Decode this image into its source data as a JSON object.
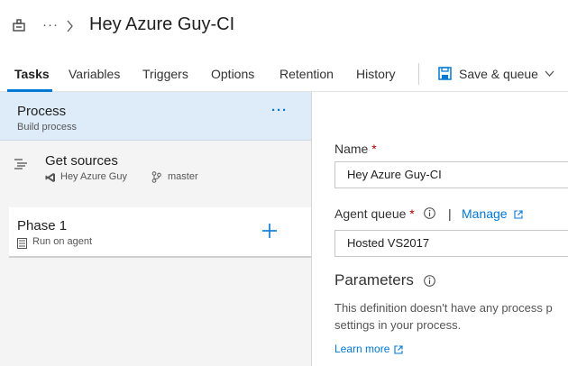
{
  "header": {
    "more": "···",
    "title": "Hey Azure Guy-CI"
  },
  "tabs": [
    {
      "label": "Tasks",
      "active": true
    },
    {
      "label": "Variables"
    },
    {
      "label": "Triggers"
    },
    {
      "label": "Options"
    },
    {
      "label": "Retention"
    },
    {
      "label": "History"
    }
  ],
  "toolbar": {
    "save_label": "Save & queue"
  },
  "process": {
    "title": "Process",
    "subtitle": "Build process",
    "more": "···"
  },
  "get_sources": {
    "title": "Get sources",
    "repo": "Hey Azure Guy",
    "branch": "master"
  },
  "phase": {
    "title": "Phase 1",
    "subtitle": "Run on agent"
  },
  "form": {
    "name_label": "Name",
    "required_mark": "*",
    "name_value": "Hey Azure Guy-CI",
    "agent_queue_label": "Agent queue",
    "pipe": "|",
    "manage_label": "Manage",
    "agent_queue_value": "Hosted VS2017",
    "parameters_title": "Parameters",
    "parameters_desc_line1": "This definition doesn't have any process p",
    "parameters_desc_line2": "settings in your process.",
    "learn_more": "Learn more"
  },
  "colors": {
    "accent": "#0078d4",
    "selected_bg": "#deecf9",
    "panel_bg": "#f4f4f4",
    "required": "#a80000"
  }
}
